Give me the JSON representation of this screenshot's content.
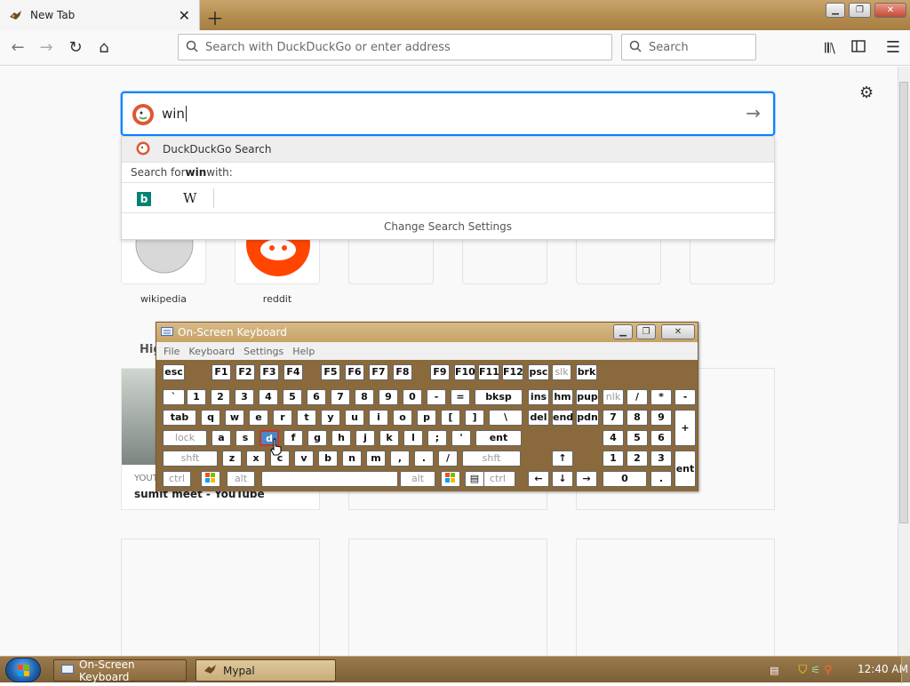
{
  "browser": {
    "tab_title": "New Tab",
    "url_placeholder": "Search with DuckDuckGo or enter address",
    "search_placeholder": "Search"
  },
  "newtab": {
    "search_text": "win",
    "dropdown": {
      "engine_label": "DuckDuckGo Search",
      "search_for_prefix": "Search for ",
      "search_for_term": "win",
      "search_for_suffix": " with:",
      "change_settings": "Change Search Settings"
    },
    "tiles": [
      {
        "label": "wikipedia"
      },
      {
        "label": "reddit"
      }
    ],
    "highlights_heading_partial": "Hig",
    "highlight_card": {
      "source_partial": "YOUT",
      "title": "sumit meet - YouTube"
    }
  },
  "osk": {
    "title": "On-Screen Keyboard",
    "menu": [
      "File",
      "Keyboard",
      "Settings",
      "Help"
    ],
    "rows": [
      [
        "esc",
        "F1",
        "F2",
        "F3",
        "F4",
        "F5",
        "F6",
        "F7",
        "F8",
        "F9",
        "F10",
        "F11",
        "F12",
        "psc",
        "slk",
        "brk"
      ],
      [
        "`",
        "1",
        "2",
        "3",
        "4",
        "5",
        "6",
        "7",
        "8",
        "9",
        "0",
        "-",
        "=",
        "bksp",
        "ins",
        "hm",
        "pup",
        "nlk",
        "/",
        "*",
        "-"
      ],
      [
        "tab",
        "q",
        "w",
        "e",
        "r",
        "t",
        "y",
        "u",
        "i",
        "o",
        "p",
        "[",
        "]",
        "\\",
        "del",
        "end",
        "pdn",
        "7",
        "8",
        "9",
        "+"
      ],
      [
        "lock",
        "a",
        "s",
        "d",
        "f",
        "g",
        "h",
        "j",
        "k",
        "l",
        ";",
        "'",
        "ent",
        "4",
        "5",
        "6"
      ],
      [
        "shft",
        "z",
        "x",
        "c",
        "v",
        "b",
        "n",
        "m",
        ",",
        ".",
        "/",
        "shft",
        "↑",
        "1",
        "2",
        "3",
        "ent"
      ],
      [
        "ctrl",
        "alt",
        "alt",
        "ctrl",
        "←",
        "↓",
        "→",
        "0",
        "."
      ]
    ],
    "pressed_key": "d"
  },
  "taskbar": {
    "tasks": [
      "On-Screen Keyboard",
      "Mypal"
    ],
    "clock": "12:40 AM"
  },
  "colors": {
    "accent": "#0a84ff",
    "theme_brown": "#8a6a3c",
    "highlight_key": "#4b87c7"
  }
}
